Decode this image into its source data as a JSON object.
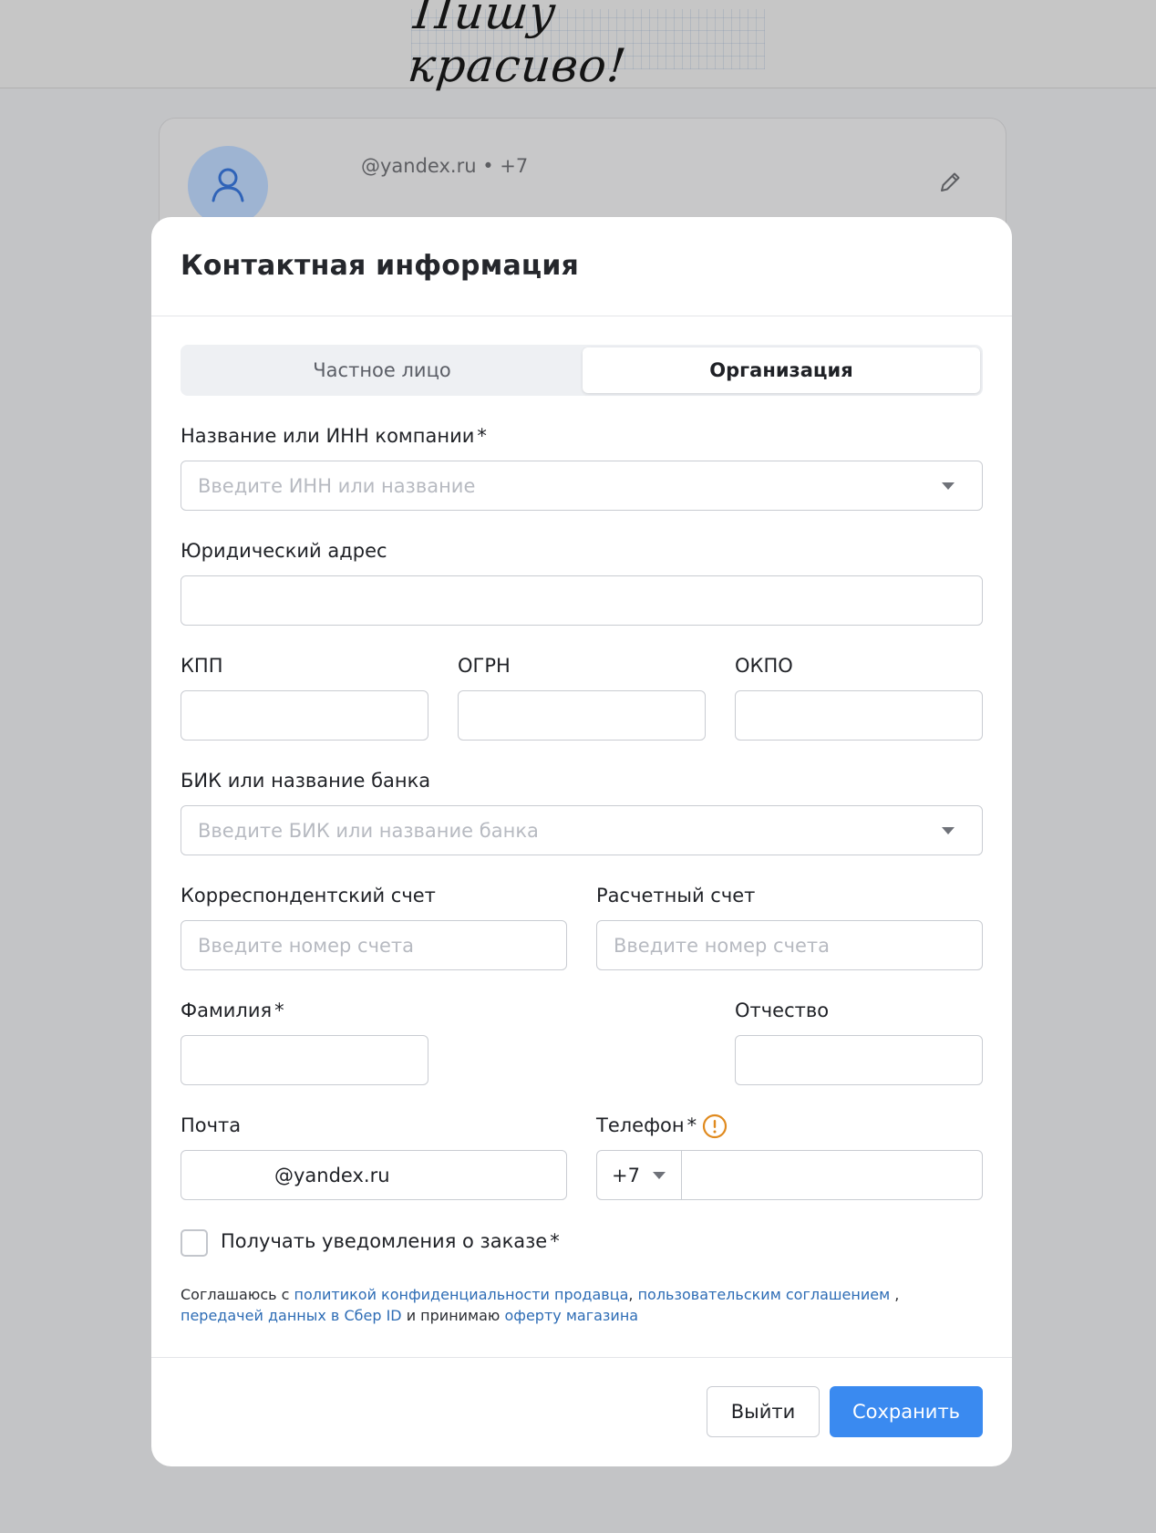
{
  "background": {
    "logo_text": "Пишу красиво!",
    "profile_contact": "@yandex.ru • +7"
  },
  "modal": {
    "title": "Контактная информация",
    "tabs": [
      {
        "label": "Частное лицо",
        "active": false
      },
      {
        "label": "Организация",
        "active": true
      }
    ],
    "company": {
      "label": "Название или ИНН компании",
      "required_mark": "*",
      "placeholder": "Введите ИНН или название",
      "value": ""
    },
    "legal_address": {
      "label": "Юридический адрес",
      "value": ""
    },
    "kpp": {
      "label": "КПП",
      "value": ""
    },
    "ogrn": {
      "label": "ОГРН",
      "value": ""
    },
    "okpo": {
      "label": "ОКПО",
      "value": ""
    },
    "bank": {
      "label": "БИК или название банка",
      "placeholder": "Введите БИК или название банка",
      "value": ""
    },
    "corr_account": {
      "label": "Корреспондентский счет",
      "placeholder": "Введите номер счета",
      "value": ""
    },
    "settlement_account": {
      "label": "Расчетный счет",
      "placeholder": "Введите номер счета",
      "value": ""
    },
    "surname": {
      "label": "Фамилия",
      "required_mark": "*",
      "value": ""
    },
    "patronymic": {
      "label": "Отчество",
      "value": ""
    },
    "email": {
      "label": "Почта",
      "value": "@yandex.ru"
    },
    "phone": {
      "label": "Телефон",
      "required_mark": "*",
      "code": "+7",
      "value": ""
    },
    "notifications": {
      "label": "Получать уведомления о заказе",
      "required_mark": "*",
      "checked": false
    },
    "legal": {
      "t1": "Соглашаюсь с ",
      "link1": "политикой конфиденциальности продавца",
      "t2": ", ",
      "link2": "пользовательским соглашением",
      "t3": " ,",
      "link3": "передачей данных в Сбер ID",
      "t4": " и принимаю ",
      "link4": "оферту магазина"
    },
    "buttons": {
      "exit": "Выйти",
      "save": "Сохранить"
    },
    "colors": {
      "primary": "#3a8af0",
      "link": "#2d6cb5",
      "warning": "#e08a1e"
    }
  }
}
